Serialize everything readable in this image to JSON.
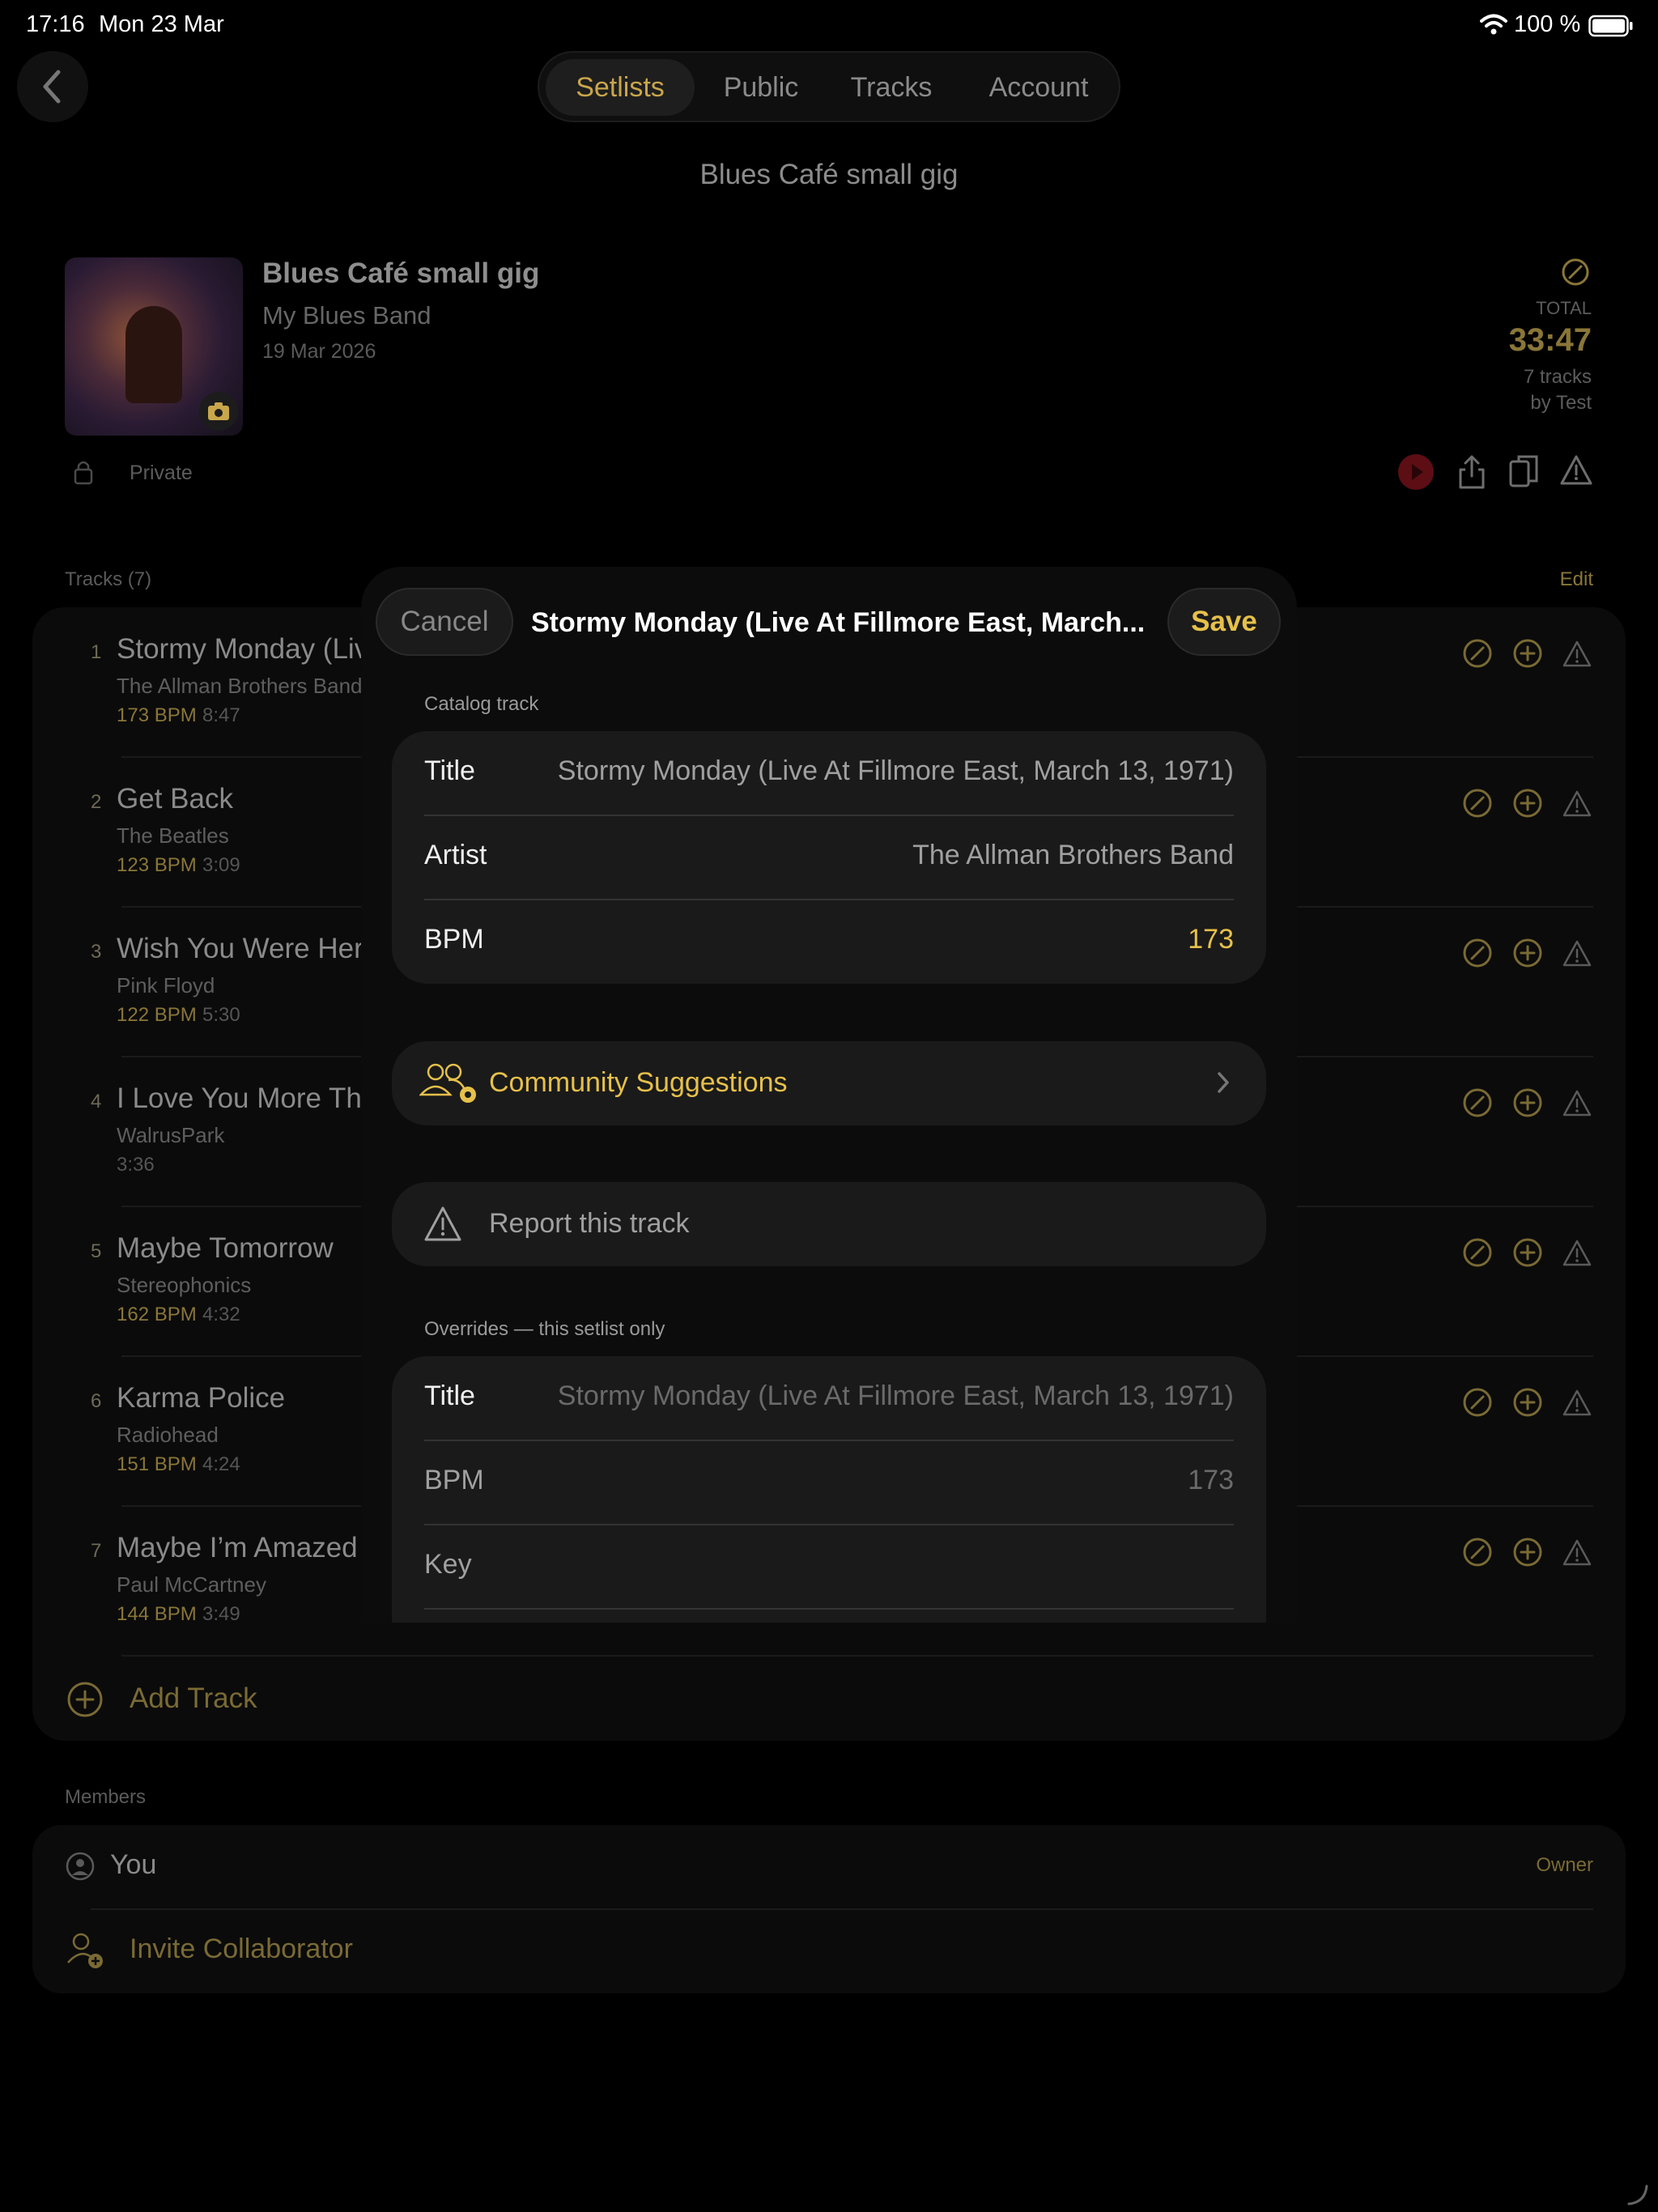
{
  "status_bar": {
    "time": "17:16",
    "date": "Mon 23 Mar",
    "battery": "100 %"
  },
  "tabs": [
    {
      "label": "Setlists",
      "active": true
    },
    {
      "label": "Public",
      "active": false
    },
    {
      "label": "Tracks",
      "active": false
    },
    {
      "label": "Account",
      "active": false
    }
  ],
  "page_title": "Blues Café small gig",
  "setlist": {
    "title": "Blues Café small gig",
    "band": "My Blues Band",
    "date": "19 Mar 2026",
    "visibility": "Private",
    "total_label": "TOTAL",
    "total_time": "33:47",
    "track_count": "7 tracks",
    "author": "by Test"
  },
  "tracks_section": {
    "label": "Tracks (7)",
    "edit": "Edit",
    "add_track": "Add Track"
  },
  "tracks": [
    {
      "num": "1",
      "title": "Stormy Monday (Live At Fillmore East, March 13, 1971)",
      "artist": "The Allman Brothers Band",
      "bpm": "173 BPM",
      "duration": "8:47"
    },
    {
      "num": "2",
      "title": "Get Back",
      "artist": "The Beatles",
      "bpm": "123 BPM",
      "duration": "3:09"
    },
    {
      "num": "3",
      "title": "Wish You Were Here",
      "artist": "Pink Floyd",
      "bpm": "122 BPM",
      "duration": "5:30"
    },
    {
      "num": "4",
      "title": "I Love You More Than",
      "artist": "WalrusPark",
      "bpm": "",
      "duration": "3:36"
    },
    {
      "num": "5",
      "title": "Maybe Tomorrow",
      "artist": "Stereophonics",
      "bpm": "162 BPM",
      "duration": "4:32"
    },
    {
      "num": "6",
      "title": "Karma Police",
      "artist": "Radiohead",
      "bpm": "151 BPM",
      "duration": "4:24"
    },
    {
      "num": "7",
      "title": "Maybe I’m Amazed",
      "artist": "Paul McCartney",
      "bpm": "144 BPM",
      "duration": "3:49"
    }
  ],
  "members": {
    "label": "Members",
    "you": "You",
    "owner": "Owner",
    "invite": "Invite Collaborator"
  },
  "modal": {
    "cancel": "Cancel",
    "title": "Stormy Monday (Live At Fillmore East, March...",
    "save": "Save",
    "catalog_label": "Catalog track",
    "catalog": {
      "title_label": "Title",
      "title_value": "Stormy Monday (Live At Fillmore East, March 13, 1971)",
      "artist_label": "Artist",
      "artist_value": "The Allman Brothers Band",
      "bpm_label": "BPM",
      "bpm_value": "173"
    },
    "community": "Community Suggestions",
    "report": "Report this track",
    "overrides_label": "Overrides — this setlist only",
    "overrides": {
      "title_label": "Title",
      "title_placeholder": "Stormy Monday (Live At Fillmore East, March 13, 1971)",
      "bpm_label": "BPM",
      "bpm_placeholder": "173",
      "key_label": "Key"
    }
  },
  "colors": {
    "accent": "#e6c04a",
    "accent_dim": "#c9a64b",
    "background": "#000000",
    "modal": "#0c0c0c",
    "group": "#1a1a1a"
  }
}
